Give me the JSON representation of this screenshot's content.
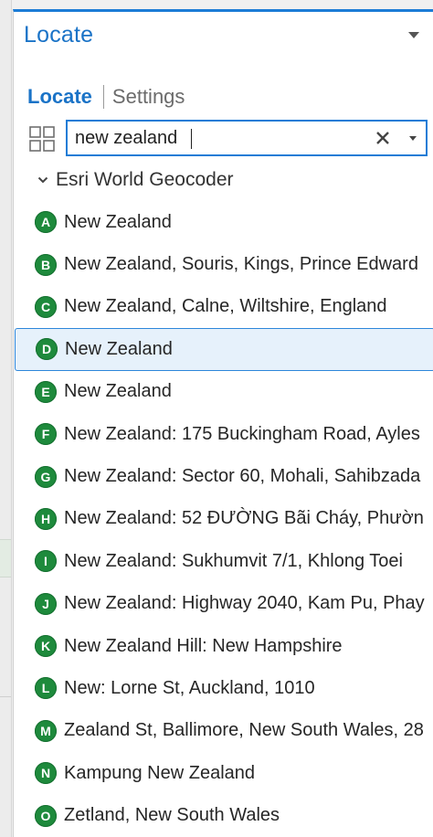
{
  "pane": {
    "title": "Locate"
  },
  "tabs": [
    {
      "label": "Locate",
      "active": true
    },
    {
      "label": "Settings",
      "active": false
    }
  ],
  "search": {
    "value": "new zealand",
    "placeholder": ""
  },
  "group": {
    "title": "Esri World Geocoder"
  },
  "results": [
    {
      "letter": "A",
      "text": "New Zealand"
    },
    {
      "letter": "B",
      "text": "New Zealand, Souris, Kings, Prince Edward"
    },
    {
      "letter": "C",
      "text": "New Zealand, Calne, Wiltshire, England"
    },
    {
      "letter": "D",
      "text": "New Zealand",
      "selected": true
    },
    {
      "letter": "E",
      "text": "New Zealand"
    },
    {
      "letter": "F",
      "text": "New Zealand: 175 Buckingham Road, Ayles"
    },
    {
      "letter": "G",
      "text": "New Zealand: Sector 60, Mohali, Sahibzada"
    },
    {
      "letter": "H",
      "text": "New Zealand: 52 ĐƯỜNG Bãi Cháy, Phườn"
    },
    {
      "letter": "I",
      "text": "New Zealand: Sukhumvit 7/1, Khlong Toei"
    },
    {
      "letter": "J",
      "text": "New Zealand: Highway 2040, Kam Pu, Phay"
    },
    {
      "letter": "K",
      "text": "New Zealand Hill: New Hampshire"
    },
    {
      "letter": "L",
      "text": "New: Lorne St, Auckland, 1010"
    },
    {
      "letter": "M",
      "text": "Zealand St, Ballimore, New South Wales, 28"
    },
    {
      "letter": "N",
      "text": "Kampung New Zealand"
    },
    {
      "letter": "O",
      "text": "Zetland, New South Wales"
    }
  ],
  "colors": {
    "accent": "#1a73c7",
    "badge": "#1e8a3c",
    "selected_bg": "#e6f1fb"
  },
  "icons": {
    "grid": "grid-view-icon",
    "clear": "close-icon",
    "dropdown": "chevron-down-icon",
    "collapse": "chevron-down-icon",
    "pane_menu": "triangle-down-icon"
  }
}
